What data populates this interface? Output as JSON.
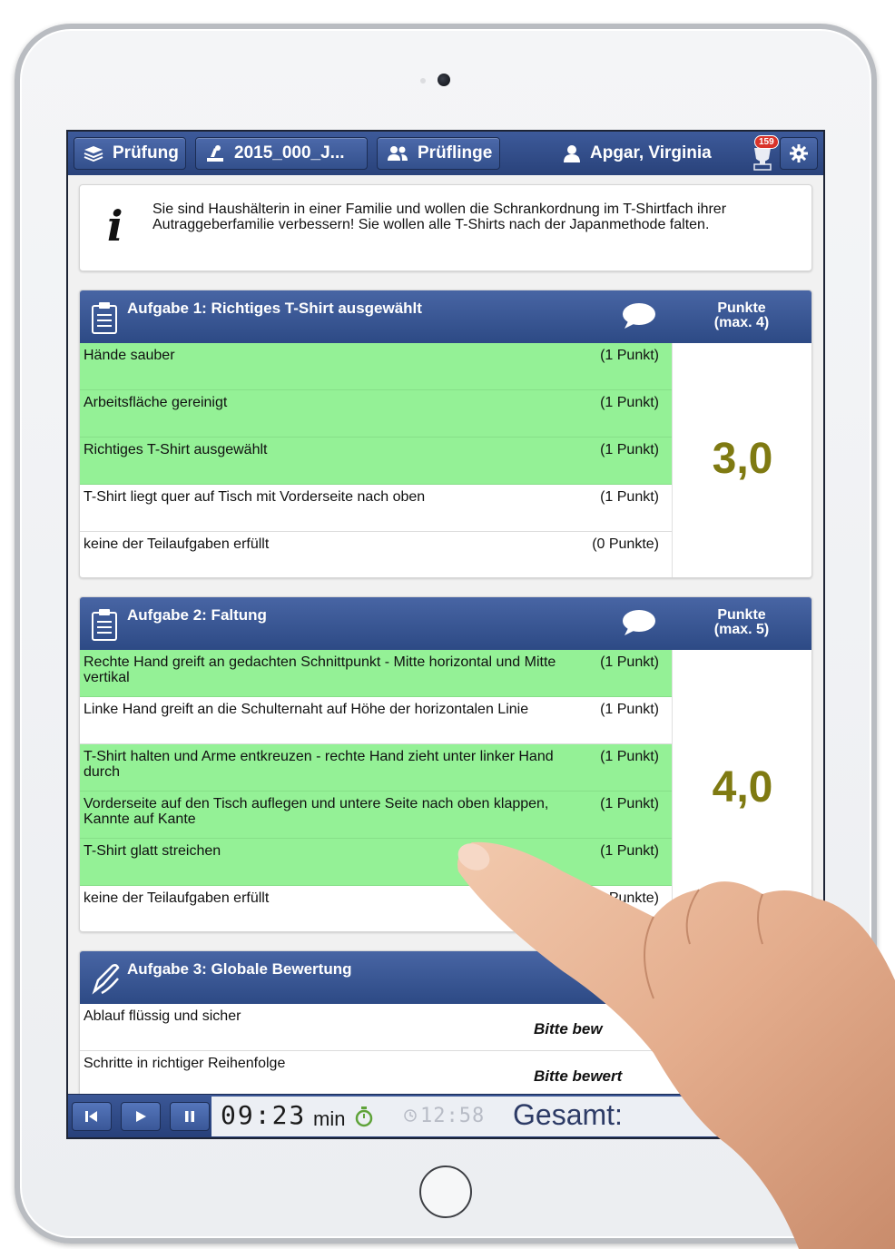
{
  "nav": {
    "pruefung_label": "Prüfung",
    "exam_id_label": "2015_000_J...",
    "candidates_label": "Prüflinge",
    "user_name": "Apgar, Virginia",
    "notification_count": "159"
  },
  "info": {
    "text": "Sie sind Haushälterin in einer Familie und wollen die Schrankordnung im T-Shirtfach ihrer Autraggeberfamilie verbessern! Sie wollen alle T-Shirts nach der Japanmethode falten."
  },
  "tasks": [
    {
      "title": "Aufgabe 1: Richtiges T-Shirt ausgewählt",
      "points_header": "Punkte",
      "points_max": "(max. 4)",
      "score": "3,0",
      "items": [
        {
          "label": "Hände sauber",
          "points": "(1 Punkt)",
          "checked": true
        },
        {
          "label": "Arbeitsfläche gereinigt",
          "points": "(1 Punkt)",
          "checked": true
        },
        {
          "label": "Richtiges T-Shirt ausgewählt",
          "points": "(1 Punkt)",
          "checked": true
        },
        {
          "label": "T-Shirt liegt quer auf Tisch mit Vorderseite nach oben",
          "points": "(1 Punkt)",
          "checked": false
        },
        {
          "label": "keine der Teilaufgaben erfüllt",
          "points": "(0 Punkte)",
          "checked": false
        }
      ]
    },
    {
      "title": "Aufgabe 2: Faltung",
      "points_header": "Punkte",
      "points_max": "(max. 5)",
      "score": "4,0",
      "items": [
        {
          "label": "Rechte Hand greift an gedachten Schnittpunkt - Mitte horizontal und Mitte vertikal",
          "points": "(1 Punkt)",
          "checked": true
        },
        {
          "label": "Linke Hand greift an die Schulternaht auf Höhe der horizontalen Linie",
          "points": "(1 Punkt)",
          "checked": false
        },
        {
          "label": "T-Shirt halten und Arme entkreuzen - rechte Hand zieht unter linker Hand durch",
          "points": "(1 Punkt)",
          "checked": true
        },
        {
          "label": "Vorderseite auf den Tisch auflegen und untere Seite nach oben klappen, Kannte auf Kante",
          "points": "(1 Punkt)",
          "checked": true
        },
        {
          "label": "T-Shirt glatt streichen",
          "points": "(1 Punkt)",
          "checked": true
        },
        {
          "label": "keine der Teilaufgaben erfüllt",
          "points": "(0 Punkte)",
          "checked": false
        }
      ]
    },
    {
      "title": "Aufgabe 3: Globale Bewertung",
      "items": [
        {
          "label": "Ablauf flüssig und sicher",
          "rating": "Bitte bew"
        },
        {
          "label": "Schritte in richtiger Reihenfolge",
          "rating": "Bitte bewert"
        }
      ]
    }
  ],
  "footer": {
    "elapsed": "09:23",
    "elapsed_unit": "min",
    "remaining": "12:58",
    "total_label": "Gesamt:"
  },
  "colors": {
    "header_blue": "#2d4a85",
    "checked_green": "#94f196",
    "score_olive": "#7f7a12"
  }
}
